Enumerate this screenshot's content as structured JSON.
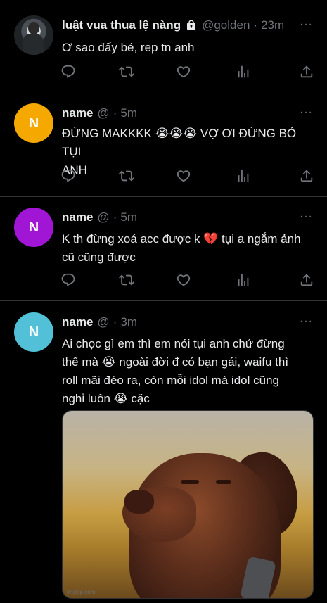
{
  "tweets": [
    {
      "avatar_letter": "",
      "name": "luật vua thua lệ nàng",
      "handle": "@golden",
      "time": "23m",
      "text": "Ơ sao đấy bé, rep tn anh",
      "avatar_color": "#2a2d30"
    },
    {
      "avatar_letter": "N",
      "name": "name",
      "handle": "@",
      "time": "5m",
      "text_line1": "ĐỪNG MAKKKK 😭😭😭 VỢ ƠI ĐỪNG BỎ TỤI",
      "text_line2": "ANH",
      "avatar_color": "#f5a800"
    },
    {
      "avatar_letter": "N",
      "name": "name",
      "handle": "@",
      "time": "5m",
      "text_line1": "K th đừng xoá acc được k 💔 tụi a ngắm ảnh",
      "text_line2": "cũ cũng được",
      "avatar_color": "#a016d4"
    },
    {
      "avatar_letter": "N",
      "name": "name",
      "handle": "@",
      "time": "3m",
      "text_line1": "Ai chọc gì em thì em nói tụi anh chứ đừng",
      "text_line2": "thế mà 😭 ngoài đời đ có bạn gái, waifu thì",
      "text_line3": "roll mãi đéo ra, còn mỗi idol mà idol cũng",
      "text_line4": "nghỉ luôn 😭 cặc",
      "avatar_color": "#52c0d6",
      "media_watermark": "imgflip.com"
    }
  ],
  "separator": "·",
  "more_label": "···",
  "icons": [
    "reply-icon",
    "retweet-icon",
    "like-icon",
    "views-icon",
    "share-icon"
  ],
  "colors": {
    "background": "#000000",
    "text": "#e7e9ea",
    "muted": "#71767b",
    "divider": "#2f3336"
  }
}
